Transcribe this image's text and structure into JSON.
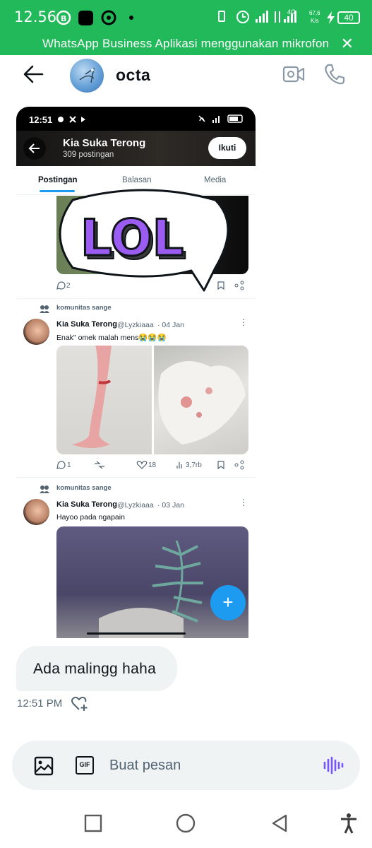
{
  "status_bar": {
    "time": "12.56",
    "net_speed": "67,6",
    "net_unit": "K/s",
    "battery": "40",
    "signal_label": "4G"
  },
  "banner": {
    "text": "WhatsApp Business Aplikasi menggunakan mikrofon"
  },
  "chat": {
    "contact_name": "octa"
  },
  "shared_screenshot": {
    "status_time": "12:51",
    "profile_name": "Kia Suka Terong",
    "post_count": "309 postingan",
    "follow_label": "Ikuti",
    "tabs": [
      "Postingan",
      "Balasan",
      "Media"
    ],
    "sticker_text": "LOL",
    "posts": [
      {
        "community": "komunitas sange",
        "author": "Kia Suka Terong",
        "handle": "@Lyzkiaaa",
        "date": "· 04 Jan",
        "text": "Enak\" omek malah mens😭😭😭",
        "replies": "1",
        "likes": "18",
        "views": "3,7rb"
      },
      {
        "community": "komunitas sange",
        "author": "Kia Suka Terong",
        "handle": "@Lyzkiaaa",
        "date": "· 03 Jan",
        "text": "Hayoo pada ngapain"
      }
    ],
    "first_post_replies": "2"
  },
  "message": {
    "text": "Ada malingg haha",
    "time": "12:51 PM"
  },
  "composer": {
    "placeholder": "Buat pesan",
    "gif_label": "GIF"
  },
  "colors": {
    "whatsapp_green": "#22b95b",
    "accent_blue": "#1d9bf0",
    "voice_purple": "#7856ff",
    "bubble_gray": "#eff3f4"
  }
}
